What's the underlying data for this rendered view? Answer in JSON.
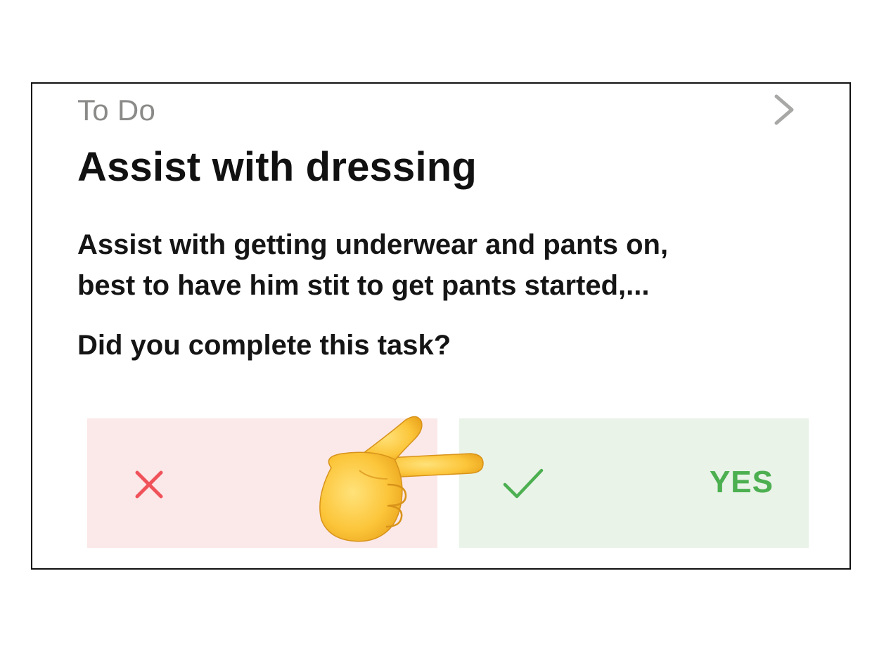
{
  "card": {
    "status_label": "To Do",
    "chevron_icon": "chevron-right-icon",
    "title": "Assist with dressing",
    "description_lines": [
      "Assist with getting underwear and pants on,",
      "best to have him stit to get pants started,..."
    ],
    "question": "Did you complete this task?",
    "buttons": {
      "no": {
        "icon": "x-icon",
        "color": "#f0525a",
        "background": "#fbe8e8"
      },
      "yes": {
        "icon": "check-icon",
        "label": "YES",
        "color": "#4caf50",
        "background": "#e9f3e8"
      }
    },
    "pointer_icon": "pointing-hand-icon"
  }
}
